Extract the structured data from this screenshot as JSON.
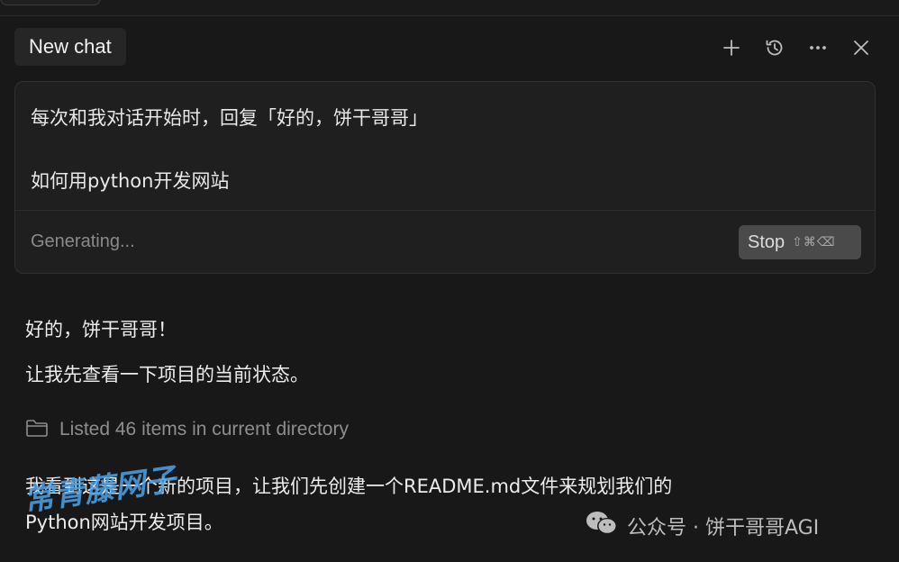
{
  "header": {
    "title": "New chat",
    "icons": [
      "plus-icon",
      "history-icon",
      "more-icon",
      "close-icon"
    ]
  },
  "prompt": {
    "line1": "每次和我对话开始时，回复「好的，饼干哥哥」",
    "line2": "如何用python开发网站",
    "status": "Generating...",
    "stop_label": "Stop",
    "stop_shortcut": "⇧⌘⌫"
  },
  "reply": {
    "line1": "好的，饼干哥哥！",
    "line2": "让我先查看一下项目的当前状态。",
    "tool_call": "Listed 46 items in current directory",
    "line3": "我看到这是一个新的项目，让我们先创建一个README.md文件来规划我们的",
    "line4": "Python网站开发项目。"
  },
  "watermarks": {
    "left": "常青藤网子",
    "right": "公众号 · 饼干哥哥AGI"
  }
}
